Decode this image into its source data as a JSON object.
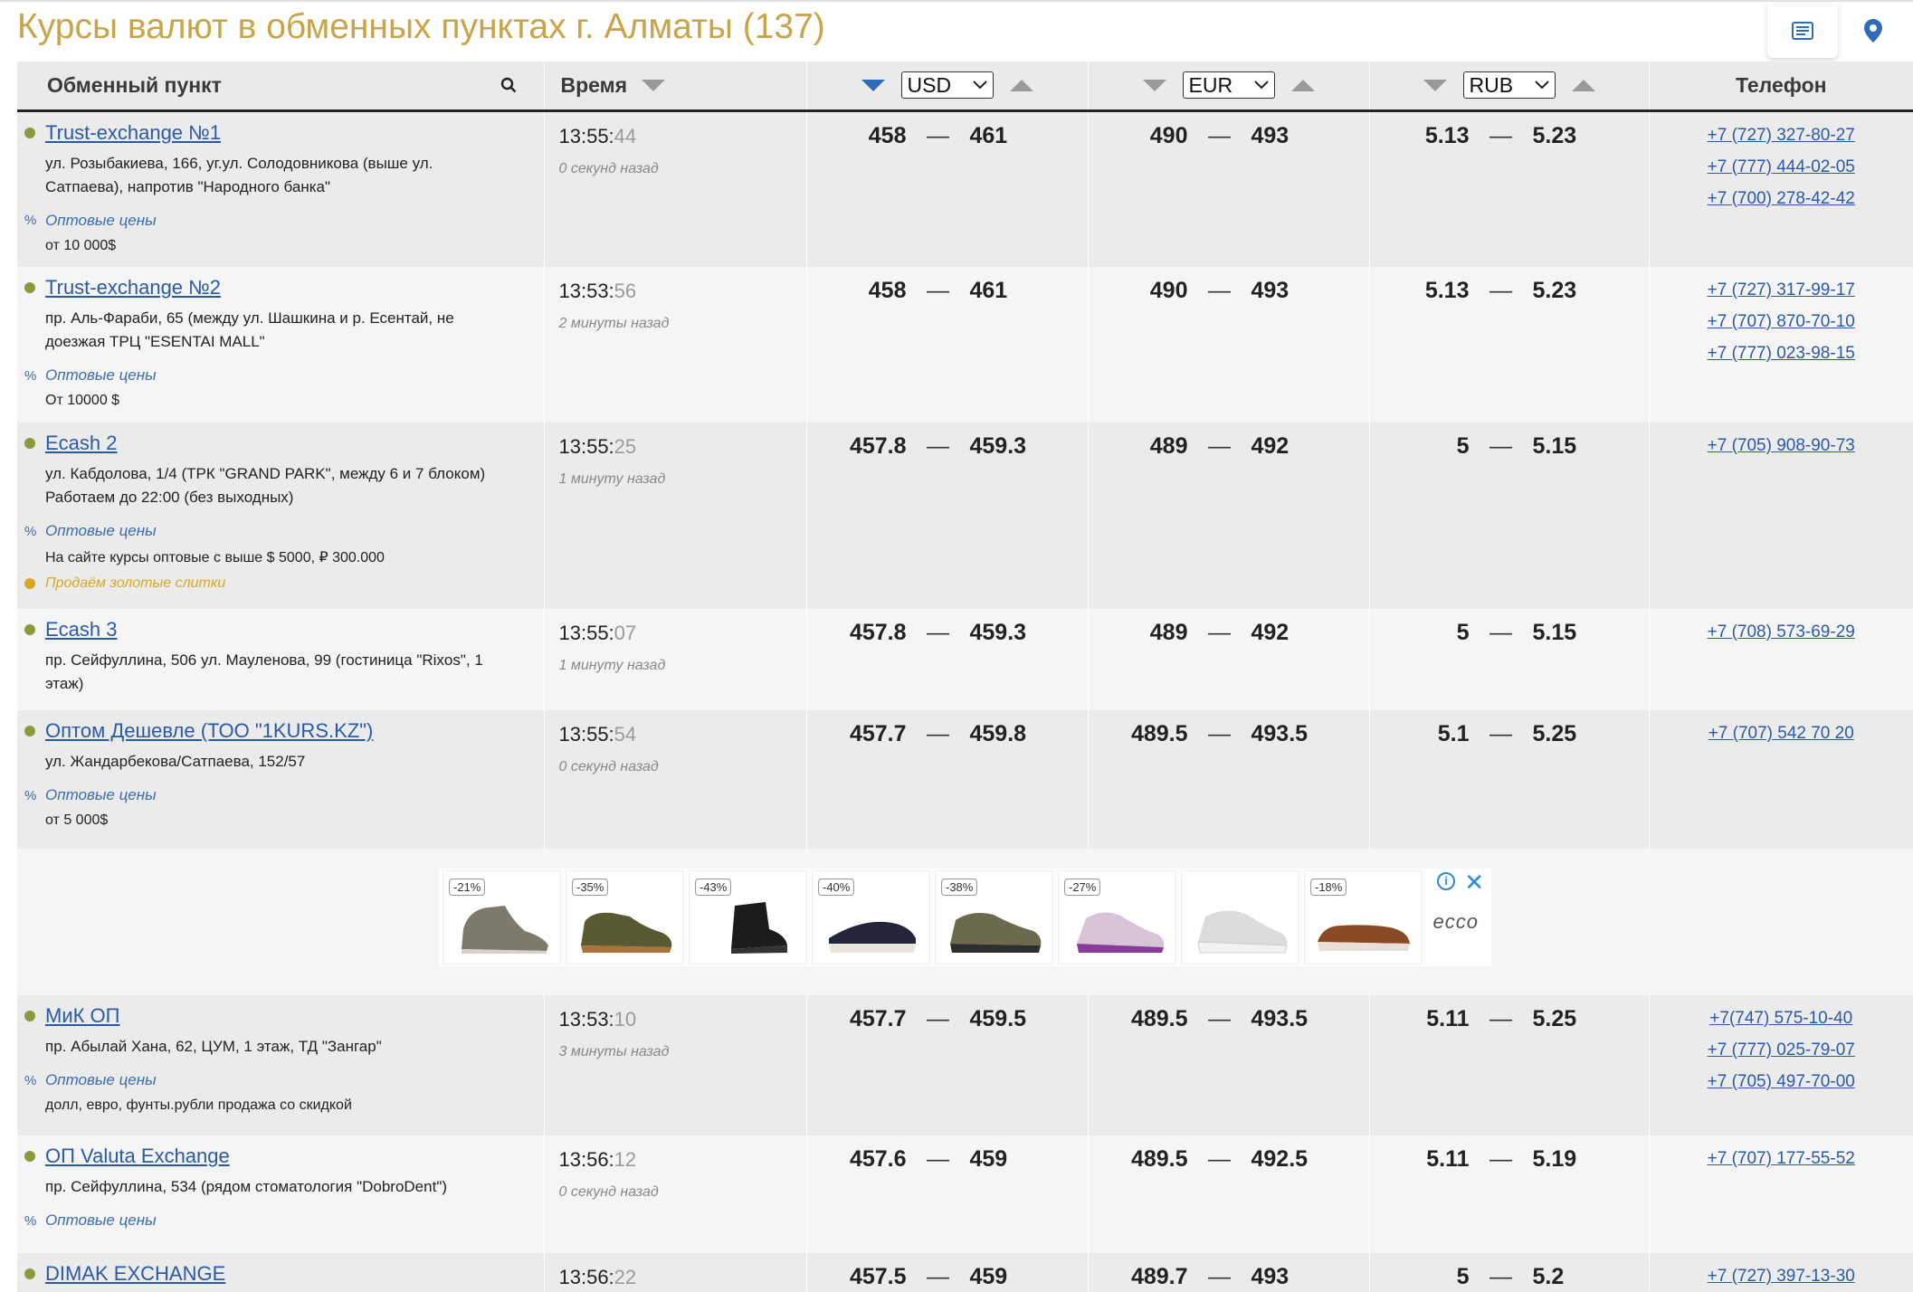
{
  "title": "Курсы валют в обменных пунктах г. Алматы (137)",
  "header": {
    "point": "Обменный пункт",
    "time": "Время",
    "cur1": "USD",
    "cur2": "EUR",
    "cur3": "RUB",
    "phone": "Телефон"
  },
  "rows": [
    {
      "name": "Trust-exchange №1",
      "addr1": "ул. Розыбакиева, 166, уг.ул. Солодовникова (выше ул.",
      "addr2": "Сатпаева), напротив \"Народного банка\"",
      "wholesale": "Оптовые цены",
      "note": "от 10 000$",
      "time_hm": "13:55:",
      "time_s": "44",
      "ago": "0 секунд назад",
      "usd": [
        "458",
        "461"
      ],
      "eur": [
        "490",
        "493"
      ],
      "rub": [
        "5.13",
        "5.23"
      ],
      "phones": [
        "+7 (727) 327-80-27",
        "+7 (777) 444-02-05",
        "+7 (700) 278-42-42"
      ]
    },
    {
      "name": "Trust-exchange №2",
      "addr1": "пр. Аль-Фараби, 65 (между ул. Шашкина и р. Есентай, не",
      "addr2": "доезжая ТРЦ \"ESENTAI MALL\"",
      "wholesale": "Оптовые цены",
      "note": "От 10000 $",
      "time_hm": "13:53:",
      "time_s": "56",
      "ago": "2 минуты назад",
      "usd": [
        "458",
        "461"
      ],
      "eur": [
        "490",
        "493"
      ],
      "rub": [
        "5.13",
        "5.23"
      ],
      "phones": [
        "+7 (727) 317-99-17",
        "+7 (707) 870-70-10",
        "+7 (777) 023-98-15"
      ]
    },
    {
      "name": "Ecash 2",
      "addr1": "ул. Кабдолова, 1/4 (ТРК \"GRAND PARK\", между 6 и 7 блоком)",
      "addr2": "Работаем до 22:00 (без выходных)",
      "wholesale": "Оптовые цены",
      "note": "На сайте курсы оптовые с выше $ 5000, ₽ 300.000",
      "gold": "Продаём золотые слитки",
      "time_hm": "13:55:",
      "time_s": "25",
      "ago": "1 минуту назад",
      "usd": [
        "457.8",
        "459.3"
      ],
      "eur": [
        "489",
        "492"
      ],
      "rub": [
        "5",
        "5.15"
      ],
      "phones": [
        "+7 (705) 908-90-73"
      ]
    },
    {
      "name": "Ecash 3",
      "addr1": "пр. Сейфуллина, 506 ул. Мауленова, 99 (гостиница \"Rixos\", 1",
      "addr2": "этаж)",
      "time_hm": "13:55:",
      "time_s": "07",
      "ago": "1 минуту назад",
      "usd": [
        "457.8",
        "459.3"
      ],
      "eur": [
        "489",
        "492"
      ],
      "rub": [
        "5",
        "5.15"
      ],
      "phones": [
        "+7 (708) 573-69-29"
      ]
    },
    {
      "name": "Оптом Дешевле (ТОО \"1KURS.KZ\")",
      "addr1": "ул. Жандарбекова/Сатпаева, 152/57",
      "wholesale": "Оптовые цены",
      "note": "от 5 000$",
      "time_hm": "13:55:",
      "time_s": "54",
      "ago": "0 секунд назад",
      "usd": [
        "457.7",
        "459.8"
      ],
      "eur": [
        "489.5",
        "493.5"
      ],
      "rub": [
        "5.1",
        "5.25"
      ],
      "phones": [
        "+7 (707) 542 70 20"
      ]
    },
    {
      "name": "МиК ОП",
      "addr1": "пр. Абылай Хана, 62, ЦУМ, 1 этаж, ТД \"Зангар\"",
      "wholesale": "Оптовые цены",
      "note": "долл, евро, фунты.рубли продажа со скидкой",
      "time_hm": "13:53:",
      "time_s": "10",
      "ago": "3 минуты назад",
      "usd": [
        "457.7",
        "459.5"
      ],
      "eur": [
        "489.5",
        "493.5"
      ],
      "rub": [
        "5.11",
        "5.25"
      ],
      "phones": [
        "+7(747) 575-10-40",
        "+7 (777) 025-79-07",
        "+7 (705) 497-70-00"
      ]
    },
    {
      "name": "ОП Valuta Exchange",
      "addr1": "пр. Сейфуллина, 534 (рядом стоматология \"DobroDent\")",
      "wholesale": "Оптовые цены",
      "time_hm": "13:56:",
      "time_s": "12",
      "ago": "0 секунд назад",
      "usd": [
        "457.6",
        "459"
      ],
      "eur": [
        "489.5",
        "492.5"
      ],
      "rub": [
        "5.11",
        "5.19"
      ],
      "phones": [
        "+7 (707) 177-55-52"
      ]
    },
    {
      "name": "DIMAK EXCHANGE",
      "time_hm": "13:56:",
      "time_s": "22",
      "usd": [
        "457.5",
        "459"
      ],
      "eur": [
        "489.7",
        "493"
      ],
      "rub": [
        "5",
        "5.2"
      ],
      "phones": [
        "+7 (727) 397-13-30"
      ]
    }
  ],
  "ad": {
    "badges": [
      "-21%",
      "-35%",
      "-43%",
      "-40%",
      "-38%",
      "-27%",
      "",
      "-18%"
    ],
    "brand": "ecco",
    "info": "i",
    "close": "✕"
  },
  "colors": {
    "title": "#c8a44a",
    "link": "#2a5aa7",
    "status_dot": "#8a9a3a",
    "gold": "#d4a923",
    "sort_active": "#2f6cb5"
  }
}
